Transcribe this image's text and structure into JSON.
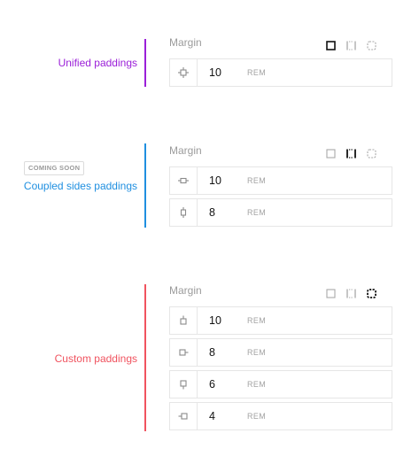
{
  "colors": {
    "unified": "#9b1fd8",
    "coupled": "#1f8fe0",
    "custom": "#f0535f",
    "active_icon": "#111111",
    "inactive_icon": "#a8a8a8"
  },
  "sections": [
    {
      "label": "Unified paddings",
      "badge": "",
      "title": "Margin",
      "active_mode": "unified",
      "rows": [
        {
          "icon": "all-sides-icon",
          "value": "10",
          "unit": "REM"
        }
      ]
    },
    {
      "label": "Coupled sides paddings",
      "badge": "COMING SOON",
      "title": "Margin",
      "active_mode": "coupled",
      "rows": [
        {
          "icon": "horizontal-sides-icon",
          "value": "10",
          "unit": "REM"
        },
        {
          "icon": "vertical-sides-icon",
          "value": "8",
          "unit": "REM"
        }
      ]
    },
    {
      "label": "Custom paddings",
      "badge": "",
      "title": "Margin",
      "active_mode": "custom",
      "rows": [
        {
          "icon": "top-side-icon",
          "value": "10",
          "unit": "REM"
        },
        {
          "icon": "right-side-icon",
          "value": "8",
          "unit": "REM"
        },
        {
          "icon": "bottom-side-icon",
          "value": "6",
          "unit": "REM"
        },
        {
          "icon": "left-side-icon",
          "value": "4",
          "unit": "REM"
        }
      ]
    }
  ]
}
